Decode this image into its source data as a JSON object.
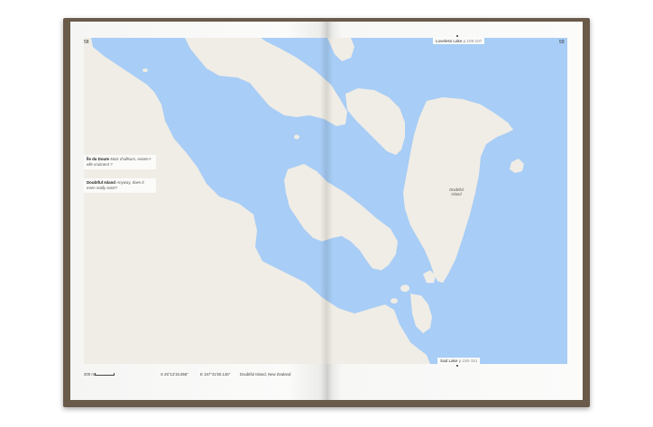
{
  "book": {
    "page_left_number": "58",
    "page_right_number": "59"
  },
  "labels": {
    "ile_du_doute": {
      "name": "Île du Doute",
      "text": "Mais d'ailleurs, existe-t-elle vraiment ?"
    },
    "doubtful_island": {
      "name": "Doubtful Island",
      "text": "Anyway, does it even really exist?"
    }
  },
  "navigation": {
    "top": {
      "name": "Loveless Lake",
      "ref": "p.106-107"
    },
    "bottom": {
      "name": "Sad Lake",
      "ref": "p.150-151"
    }
  },
  "map": {
    "island_label": "Doubtful\nIsland",
    "water_color": "#a8cdf6",
    "land_color": "#f0ede6"
  },
  "footer": {
    "scale": "200 m",
    "lat": "S 45°12'15.855\"",
    "lon": "E 167°41'50.146\"",
    "place": "Doubtful Island, New Zealand"
  }
}
